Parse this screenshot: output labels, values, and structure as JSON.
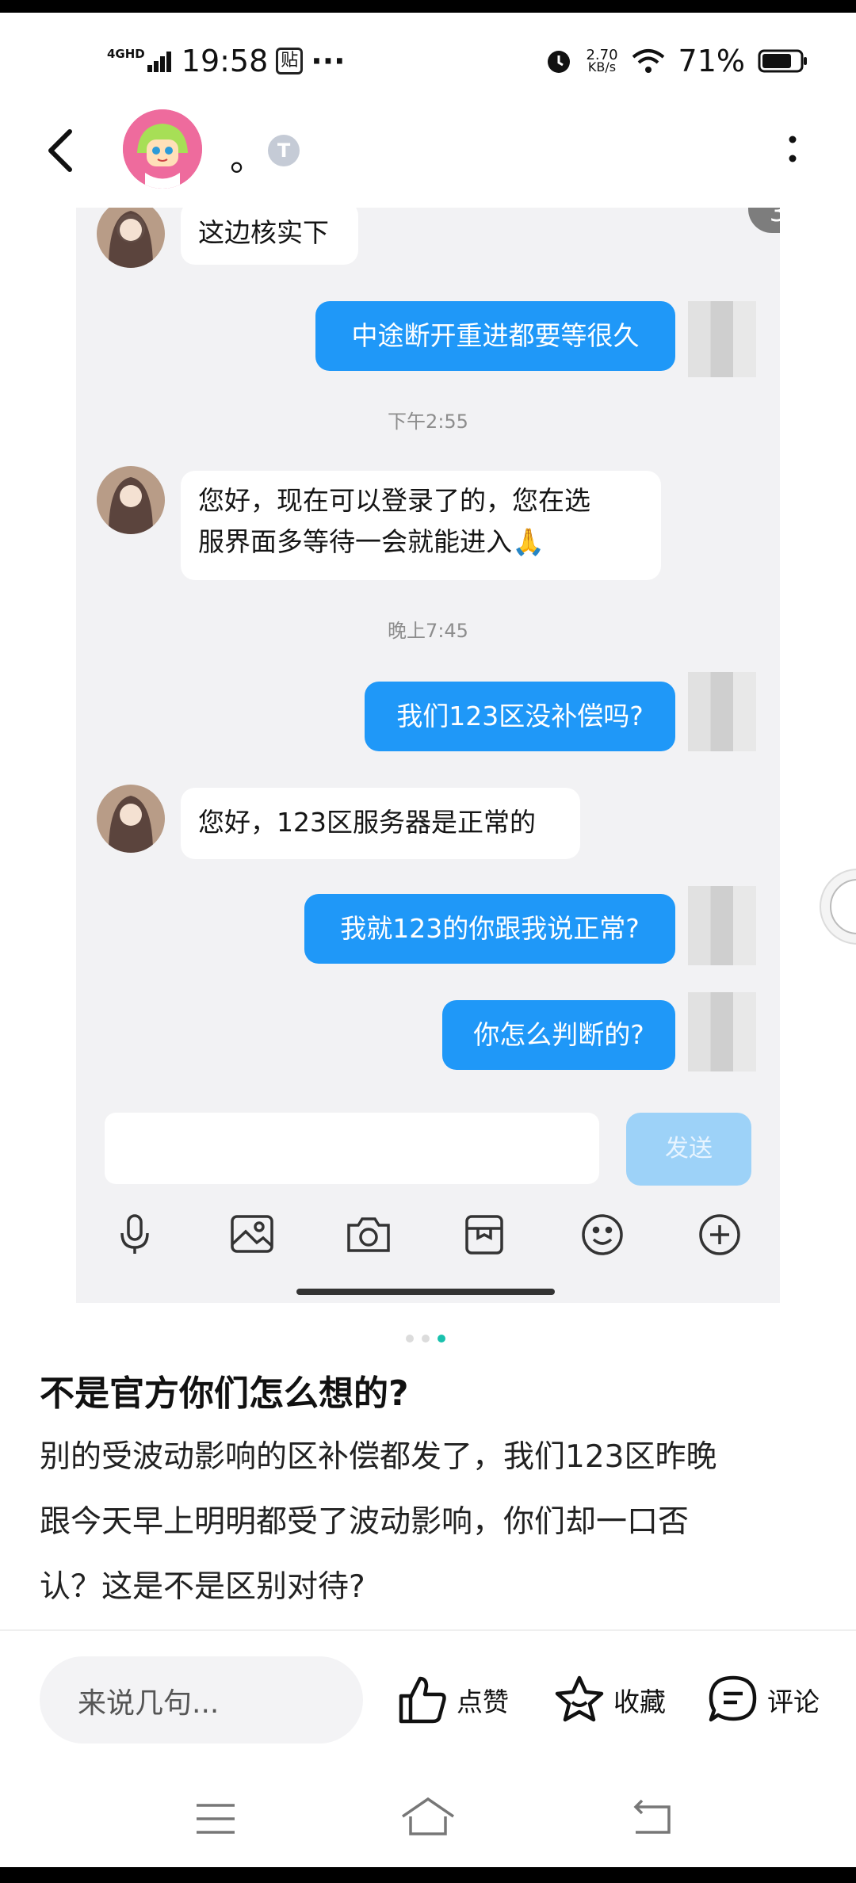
{
  "status_bar": {
    "network": "4GHD",
    "time": "19:58",
    "app_badge": "贴",
    "more": "···",
    "speed_value": "2.70",
    "speed_unit": "KB/s",
    "battery": "71%"
  },
  "header": {
    "title": "。",
    "level_badge": "T"
  },
  "screenshot": {
    "page_indicator": "3/3",
    "messages": [
      {
        "side": "in",
        "text": "这边核实下"
      },
      {
        "side": "out",
        "text": "中途断开重进都要等很久"
      },
      {
        "side": "time",
        "text": "下午2:55"
      },
      {
        "side": "in",
        "line1": "您好，现在可以登录了的，您在选",
        "line2": "服界面多等待一会就能进入🙏"
      },
      {
        "side": "time",
        "text": "晚上7:45"
      },
      {
        "side": "out",
        "text": "我们123区没补偿吗?"
      },
      {
        "side": "in",
        "text": "您好，123区服务器是正常的"
      },
      {
        "side": "out",
        "text": "我就123的你跟我说正常?"
      },
      {
        "side": "out",
        "text": "你怎么判断的?"
      }
    ],
    "send_label": "发送",
    "toolbar_icons": [
      "microphone-icon",
      "image-icon",
      "camera-icon",
      "sticker-icon",
      "emoji-icon",
      "plus-icon"
    ]
  },
  "post": {
    "title": "不是官方你们怎么想的?",
    "body_lines": [
      "别的受波动影响的区补偿都发了，我们123区昨晚",
      "跟今天早上明明都受了波动影响，你们却一口否",
      "认？这是不是区别对待?"
    ]
  },
  "bottom_bar": {
    "comment_placeholder": "来说几句...",
    "like_label": "点赞",
    "favorite_label": "收藏",
    "comment_label": "评论"
  },
  "colors": {
    "bubble_blue": "#1f98f8",
    "send_disabled": "#9dd2f8",
    "carousel_active": "#19c1ad"
  }
}
